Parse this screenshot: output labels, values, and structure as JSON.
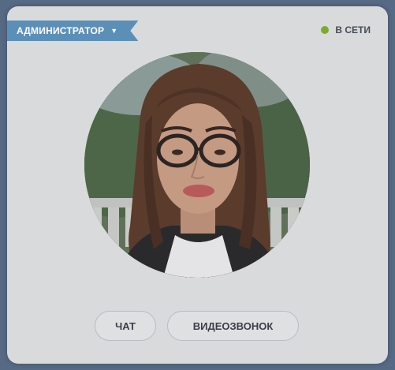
{
  "card": {
    "role_label": "АДМИНИСТРАТОР",
    "role_dropdown_icon": "chevron-down-icon",
    "status_label": "В СЕТИ",
    "status_color": "#7bab2c",
    "accent_color": "#5c8fb7"
  },
  "actions": {
    "chat_label": "ЧАТ",
    "video_call_label": "ВИДЕОЗВОНОК"
  }
}
